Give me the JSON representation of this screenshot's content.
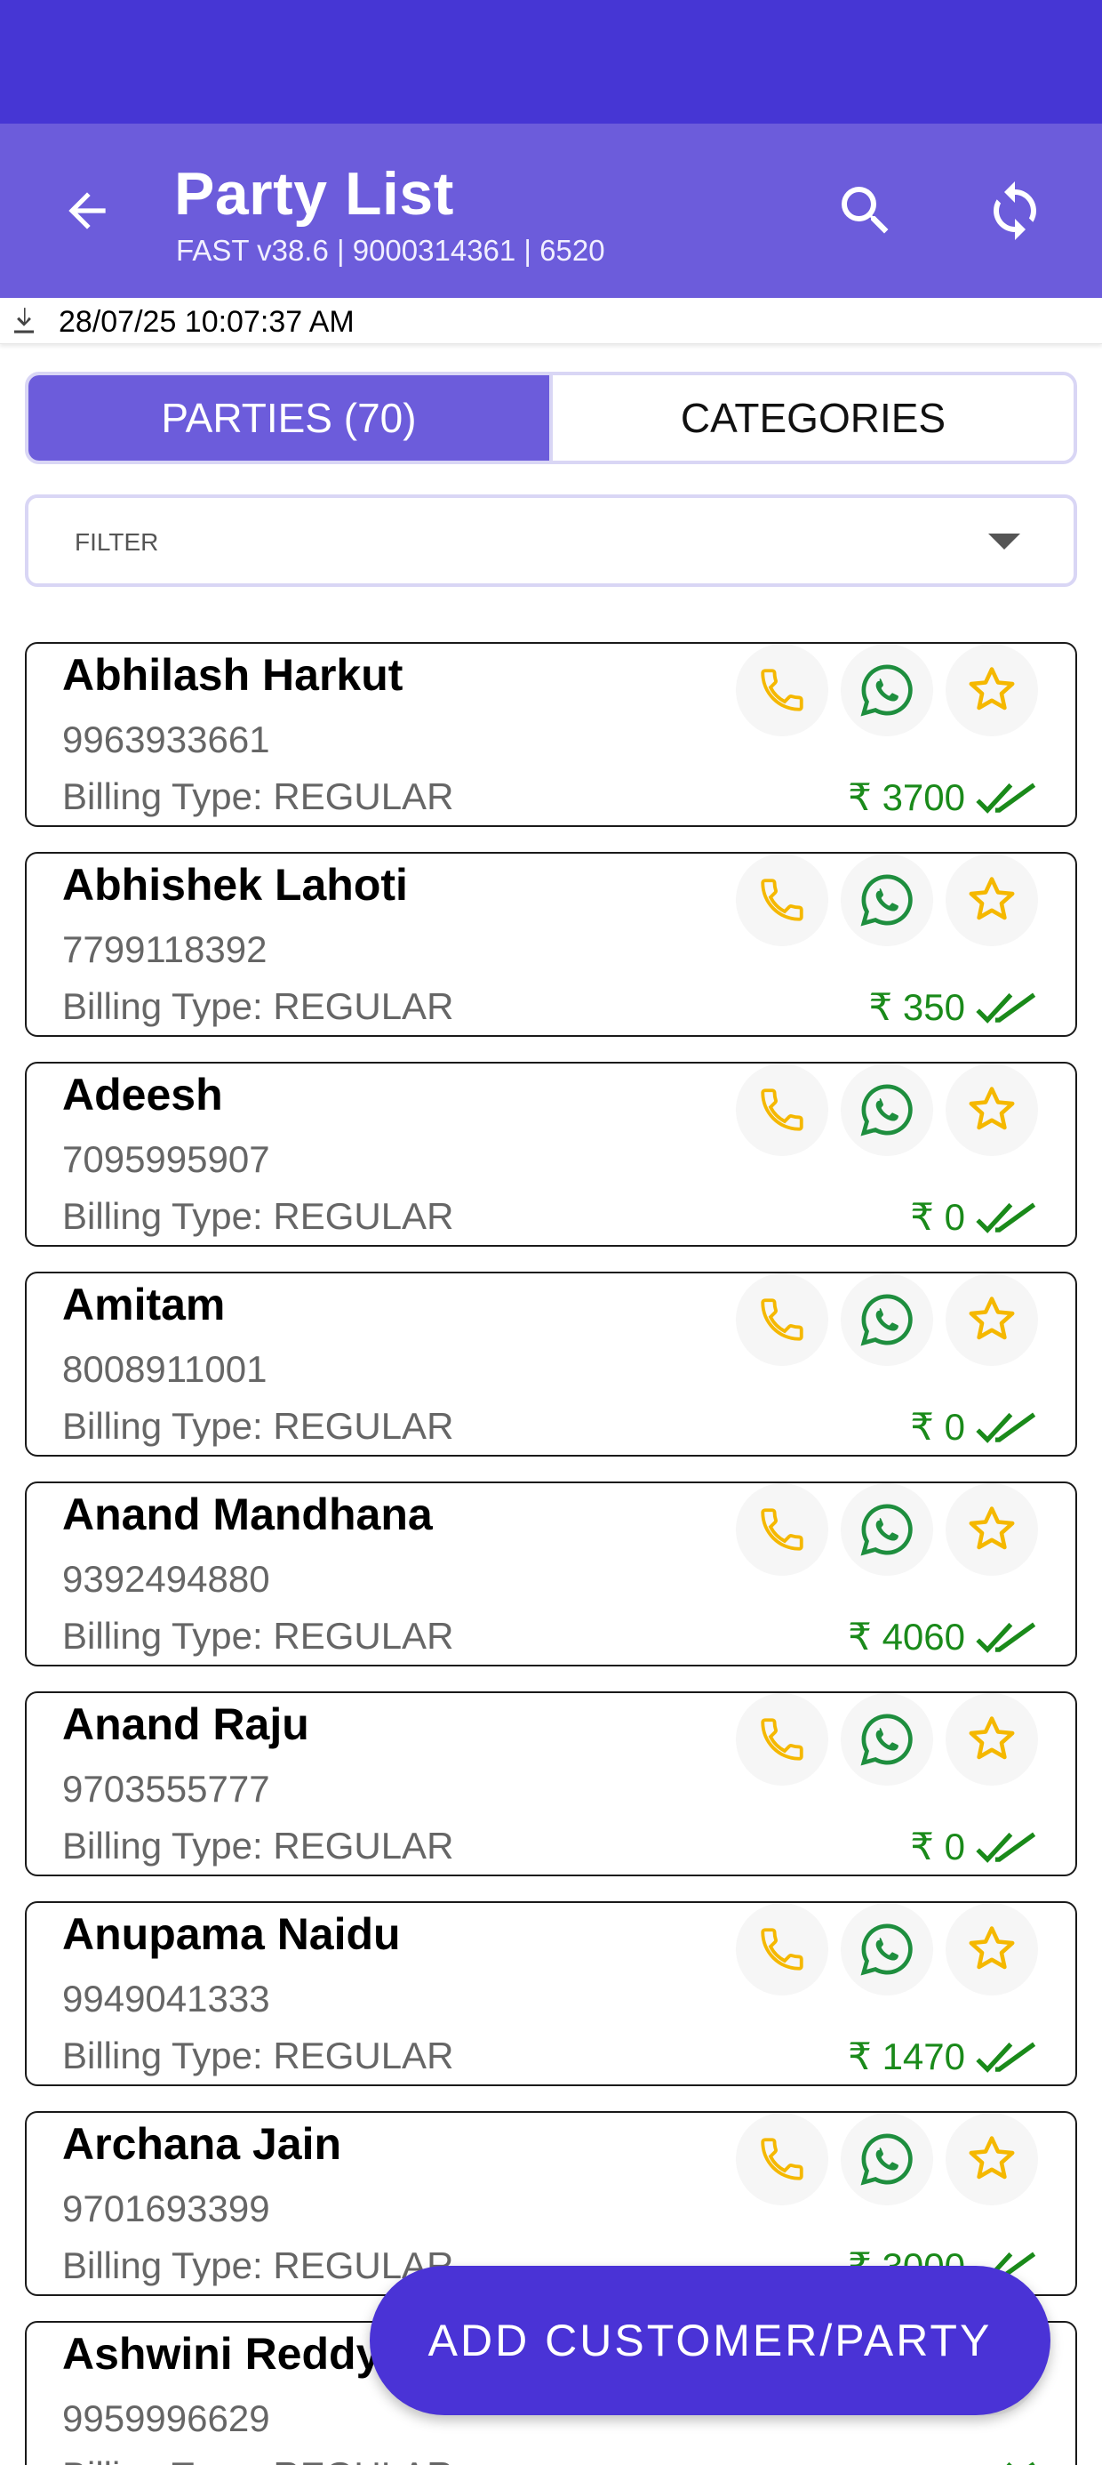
{
  "app_bar": {
    "title": "Party List",
    "subtitle": "FAST v38.6 | 9000314361 | 6520"
  },
  "sync": {
    "timestamp": "28/07/25 10:07:37 AM"
  },
  "tabs": [
    {
      "label": "PARTIES (70)",
      "active": true
    },
    {
      "label": "CATEGORIES",
      "active": false
    }
  ],
  "filter": {
    "label": "FILTER"
  },
  "parties": [
    {
      "name": "Abhilash Harkut",
      "phone": "9963933661",
      "billing": "Billing Type: REGULAR",
      "amount": "₹ 3700"
    },
    {
      "name": "Abhishek Lahoti",
      "phone": "7799118392",
      "billing": "Billing Type: REGULAR",
      "amount": "₹ 350"
    },
    {
      "name": "Adeesh",
      "phone": "7095995907",
      "billing": "Billing Type: REGULAR",
      "amount": "₹ 0"
    },
    {
      "name": "Amitam",
      "phone": "8008911001",
      "billing": "Billing Type: REGULAR",
      "amount": "₹ 0"
    },
    {
      "name": "Anand Mandhana",
      "phone": "9392494880",
      "billing": "Billing Type: REGULAR",
      "amount": "₹ 4060"
    },
    {
      "name": "Anand Raju",
      "phone": "9703555777",
      "billing": "Billing Type: REGULAR",
      "amount": "₹ 0"
    },
    {
      "name": "Anupama Naidu",
      "phone": "9949041333",
      "billing": "Billing Type: REGULAR",
      "amount": "₹ 1470"
    },
    {
      "name": "Archana Jain",
      "phone": "9701693399",
      "billing": "Billing Type: REGULAR",
      "amount": "₹ 3000"
    },
    {
      "name": "Ashwini Reddy",
      "phone": "9959996629",
      "billing": "Billing Type: REGULAR",
      "amount": ""
    }
  ],
  "fab": {
    "label": "ADD CUSTOMER/PARTY"
  },
  "colors": {
    "status_bar": "#4636d4",
    "app_bar": "#6c5cdb",
    "fab": "#4a33d6",
    "amount_green": "#1a8a1a",
    "call_yellow": "#f5b800",
    "whatsapp_green": "#1e8e3e"
  },
  "icons": {
    "back": "arrow-left-icon",
    "search": "search-icon",
    "refresh": "refresh-icon",
    "download": "download-icon",
    "call": "phone-icon",
    "whatsapp": "whatsapp-icon",
    "favorite": "star-outline-icon",
    "status": "double-check-icon"
  }
}
